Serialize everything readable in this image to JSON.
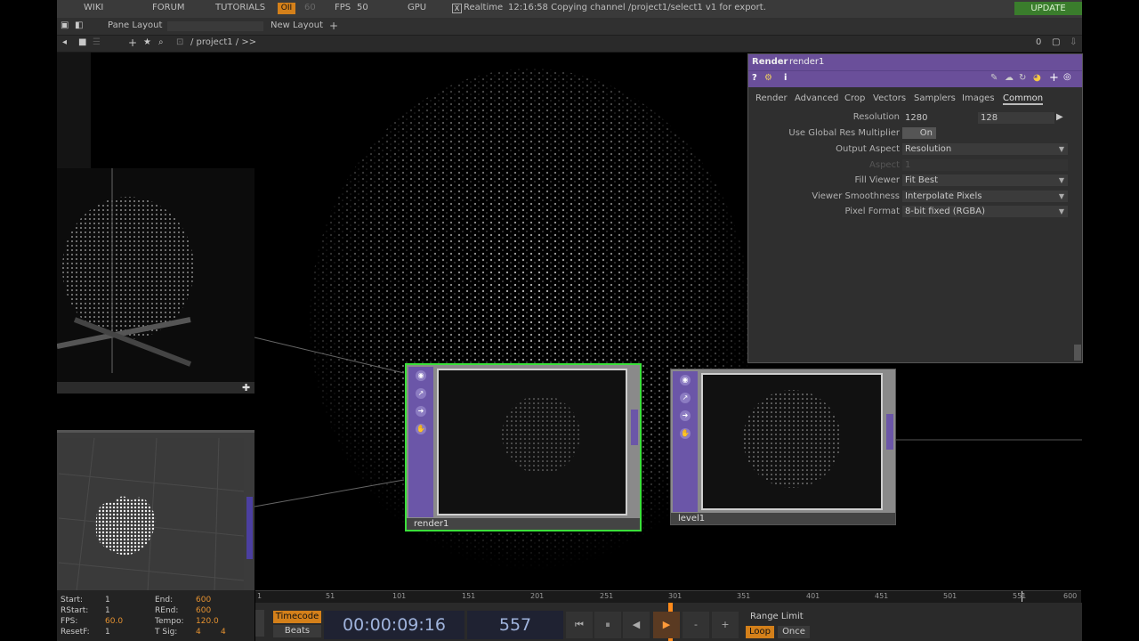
{
  "topbar": {
    "wiki": "WIKI",
    "forum": "FORUM",
    "tutorials": "TUTORIALS",
    "oi": "OII",
    "sixty": "60",
    "fps_label": "FPS",
    "fps_value": "50",
    "gpu": "GPU",
    "realtime_check": "X",
    "realtime": "Realtime",
    "status": "12:16:58 Copying channel /project1/select1 v1 for export.",
    "update": "UPDATE"
  },
  "bar2": {
    "pane_layout": "Pane Layout",
    "new_layout": "New Layout",
    "add": "+"
  },
  "bar3": {
    "path": "/ project1 / >>",
    "counter": "0"
  },
  "params": {
    "type": "Render",
    "name": "render1",
    "tabs": [
      "Render",
      "Advanced",
      "Crop",
      "Vectors",
      "Samplers",
      "Images",
      "Common"
    ],
    "rows": [
      {
        "label": "Resolution",
        "value": "1280",
        "value2": "128"
      },
      {
        "label": "Use Global Res Multiplier",
        "value": "On"
      },
      {
        "label": "Output Aspect",
        "value": "Resolution"
      },
      {
        "label": "Aspect",
        "value": "1"
      },
      {
        "label": "Fill Viewer",
        "value": "Fit Best"
      },
      {
        "label": "Viewer Smoothness",
        "value": "Interpolate Pixels"
      },
      {
        "label": "Pixel Format",
        "value": "8-bit fixed (RGBA)"
      }
    ]
  },
  "nodes": {
    "render1": "render1",
    "level1": "level1"
  },
  "ruler": [
    "1",
    "51",
    "101",
    "151",
    "201",
    "251",
    "301",
    "351",
    "401",
    "451",
    "501",
    "551",
    "600"
  ],
  "info": {
    "start_k": "Start:",
    "start_v": "1",
    "end_k": "End:",
    "end_v": "600",
    "rstart_k": "RStart:",
    "rstart_v": "1",
    "rend_k": "REnd:",
    "rend_v": "600",
    "fps_k": "FPS:",
    "fps_v": "60.0",
    "tempo_k": "Tempo:",
    "tempo_v": "120.0",
    "resetf_k": "ResetF:",
    "resetf_v": "1",
    "tsig_k": "T Sig:",
    "tsig_v1": "4",
    "tsig_v2": "4"
  },
  "transport": {
    "timecode_btn": "Timecode",
    "beats_btn": "Beats",
    "timecode": "00:00:09:16",
    "frame": "557",
    "range_limit": "Range Limit",
    "loop": "Loop",
    "once": "Once",
    "minus": "-",
    "plus": "+"
  }
}
